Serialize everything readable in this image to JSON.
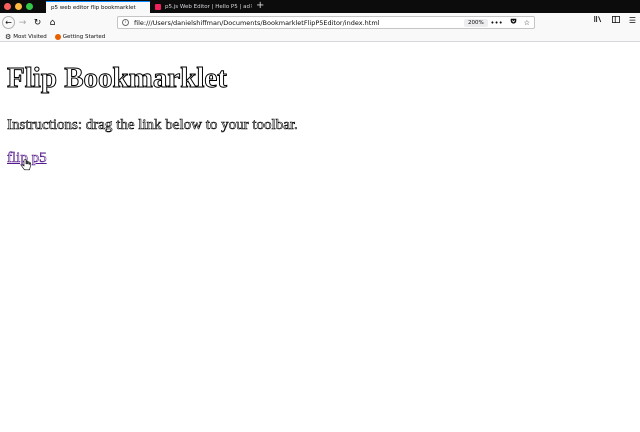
{
  "window": {
    "traffic_lights": [
      "#fc605c",
      "#fdbc40",
      "#34c84a"
    ]
  },
  "tabs": [
    {
      "label": "p5 web editor flip bookmarklet",
      "active": true
    },
    {
      "label": "p5.js Web Editor | Hello P5 | ad",
      "active": false
    }
  ],
  "new_tab_label": "+",
  "toolbar": {
    "back_icon": "back-arrow-icon",
    "forward_icon": "forward-arrow-icon",
    "reload_icon": "reload-icon",
    "home_icon": "home-icon",
    "url": "file:///Users/danielshiffman/Documents/BookmarkletFlipP5Editor/index.html",
    "zoom": "200%",
    "more_label": "•••"
  },
  "bookmarks": [
    {
      "label": "Most Visited",
      "icon": "gear-icon"
    },
    {
      "label": "Getting Started",
      "icon": "firefox-icon"
    }
  ],
  "page": {
    "title": "Flip Bookmarklet",
    "instructions": "Instructions: drag the link below to your toolbar.",
    "link_text": "flip p5"
  }
}
